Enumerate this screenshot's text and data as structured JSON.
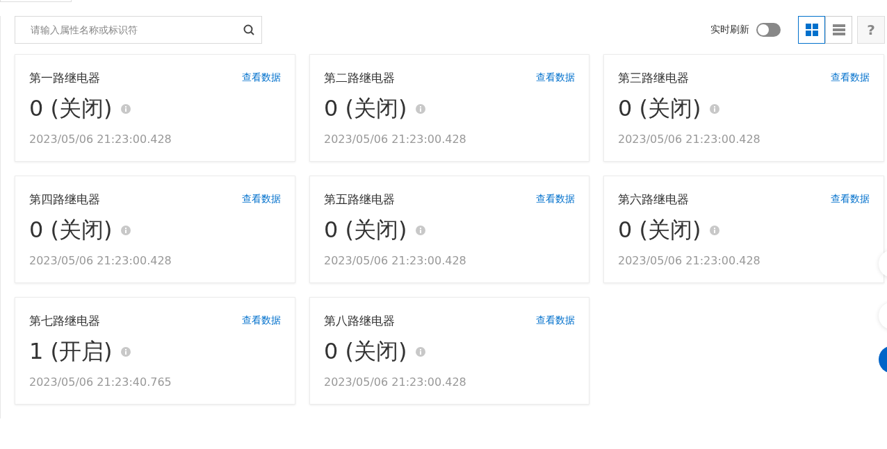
{
  "search": {
    "placeholder": "请输入属性名称或标识符"
  },
  "refresh": {
    "label": "实时刷新",
    "on": false
  },
  "view_buttons": [
    {
      "kind": "grid",
      "selected": true
    },
    {
      "kind": "list",
      "selected": false
    }
  ],
  "help_button": "?",
  "cards": [
    {
      "title": "第一路继电器",
      "link": "查看数据",
      "value": "0 (关闭)",
      "time": "2023/05/06 21:23:00.428"
    },
    {
      "title": "第二路继电器",
      "link": "查看数据",
      "value": "0 (关闭)",
      "time": "2023/05/06 21:23:00.428"
    },
    {
      "title": "第三路继电器",
      "link": "查看数据",
      "value": "0 (关闭)",
      "time": "2023/05/06 21:23:00.428"
    },
    {
      "title": "第四路继电器",
      "link": "查看数据",
      "value": "0 (关闭)",
      "time": "2023/05/06 21:23:00.428"
    },
    {
      "title": "第五路继电器",
      "link": "查看数据",
      "value": "0 (关闭)",
      "time": "2023/05/06 21:23:00.428"
    },
    {
      "title": "第六路继电器",
      "link": "查看数据",
      "value": "0 (关闭)",
      "time": "2023/05/06 21:23:00.428"
    },
    {
      "title": "第七路继电器",
      "link": "查看数据",
      "value": "1 (开启)",
      "time": "2023/05/06 21:23:40.765"
    },
    {
      "title": "第八路继电器",
      "link": "查看数据",
      "value": "0 (关闭)",
      "time": "2023/05/06 21:23:00.428"
    }
  ]
}
